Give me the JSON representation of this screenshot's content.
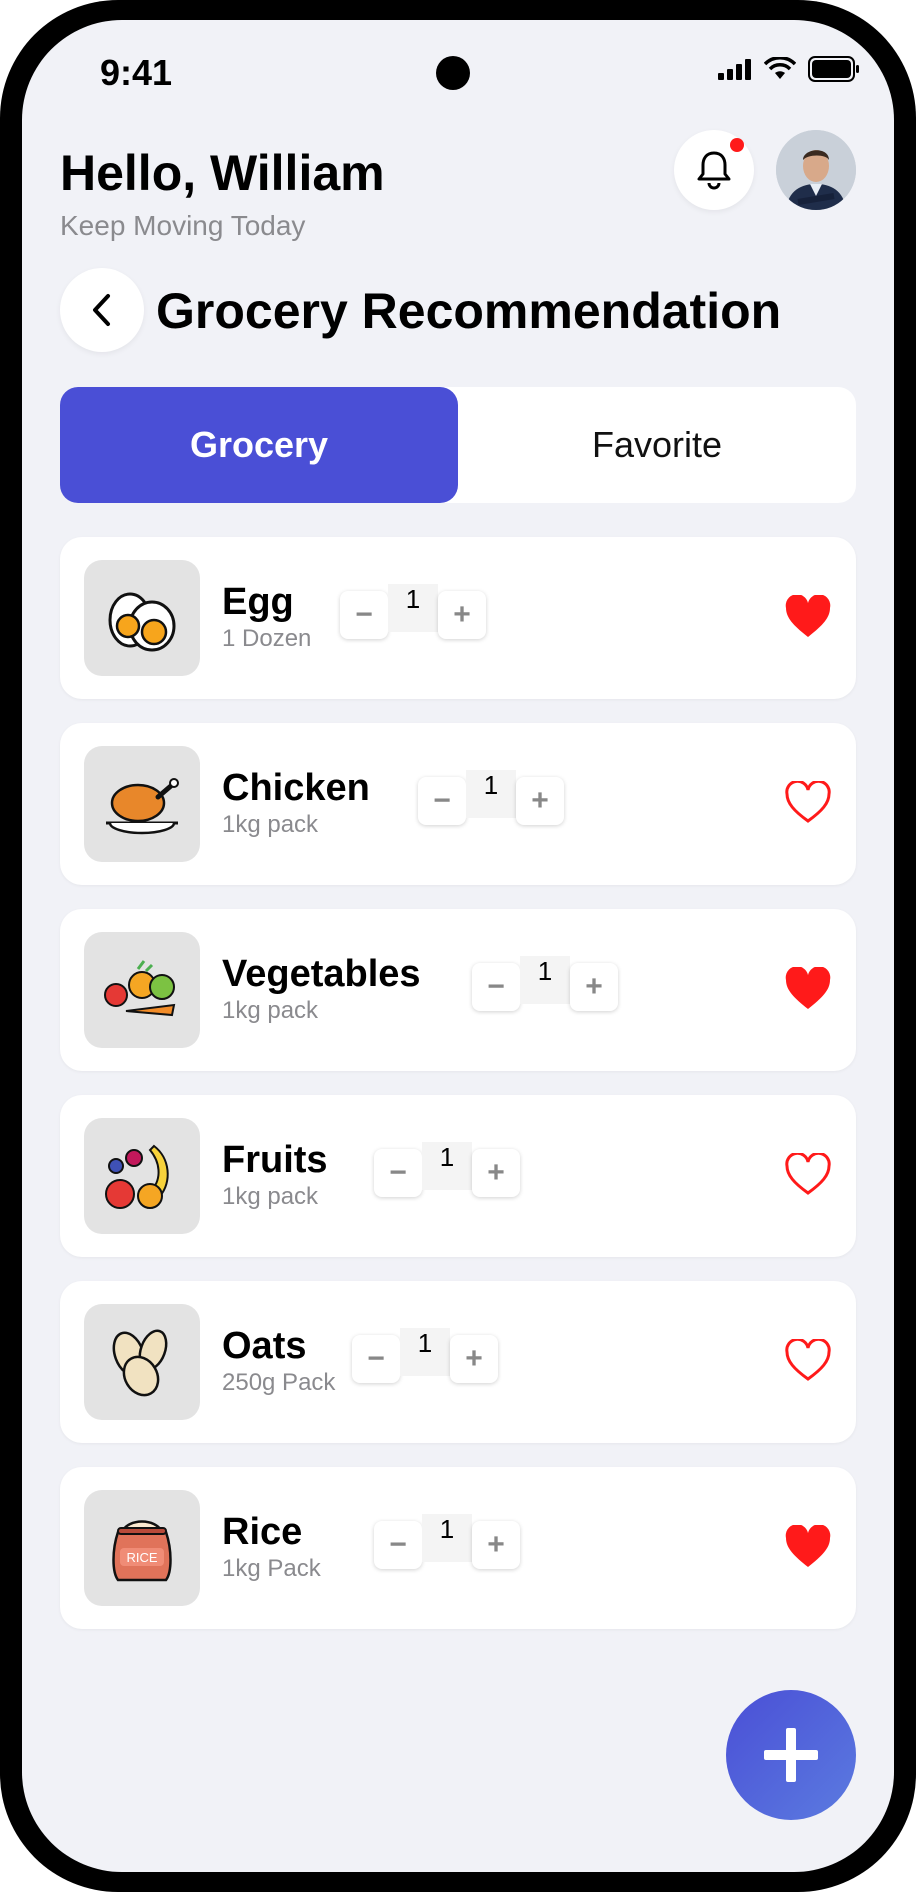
{
  "status_bar": {
    "time": "9:41"
  },
  "header": {
    "greeting": "Hello, William",
    "subtitle": "Keep Moving Today"
  },
  "page": {
    "title": "Grocery Recommendation"
  },
  "tabs": [
    {
      "label": "Grocery",
      "active": true
    },
    {
      "label": "Favorite",
      "active": false
    }
  ],
  "items": [
    {
      "name": "Egg",
      "unit": "1 Dozen",
      "quantity": "1",
      "favorite": true,
      "icon": "egg-icon"
    },
    {
      "name": "Chicken",
      "unit": "1kg pack",
      "quantity": "1",
      "favorite": false,
      "icon": "roast-chicken-icon"
    },
    {
      "name": "Vegetables",
      "unit": "1kg pack",
      "quantity": "1",
      "favorite": true,
      "icon": "vegetables-icon"
    },
    {
      "name": "Fruits",
      "unit": "1kg pack",
      "quantity": "1",
      "favorite": false,
      "icon": "fruits-icon"
    },
    {
      "name": "Oats",
      "unit": "250g Pack",
      "quantity": "1",
      "favorite": false,
      "icon": "oats-icon"
    },
    {
      "name": "Rice",
      "unit": "1kg Pack",
      "quantity": "1",
      "favorite": true,
      "icon": "rice-bag-icon"
    }
  ],
  "rice_bag_label": "RICE",
  "stepper": {
    "minus": "−",
    "plus": "+"
  },
  "colors": {
    "accent": "#4a4fd6",
    "favorite": "#ff1a1a",
    "background": "#f1f2f7"
  }
}
